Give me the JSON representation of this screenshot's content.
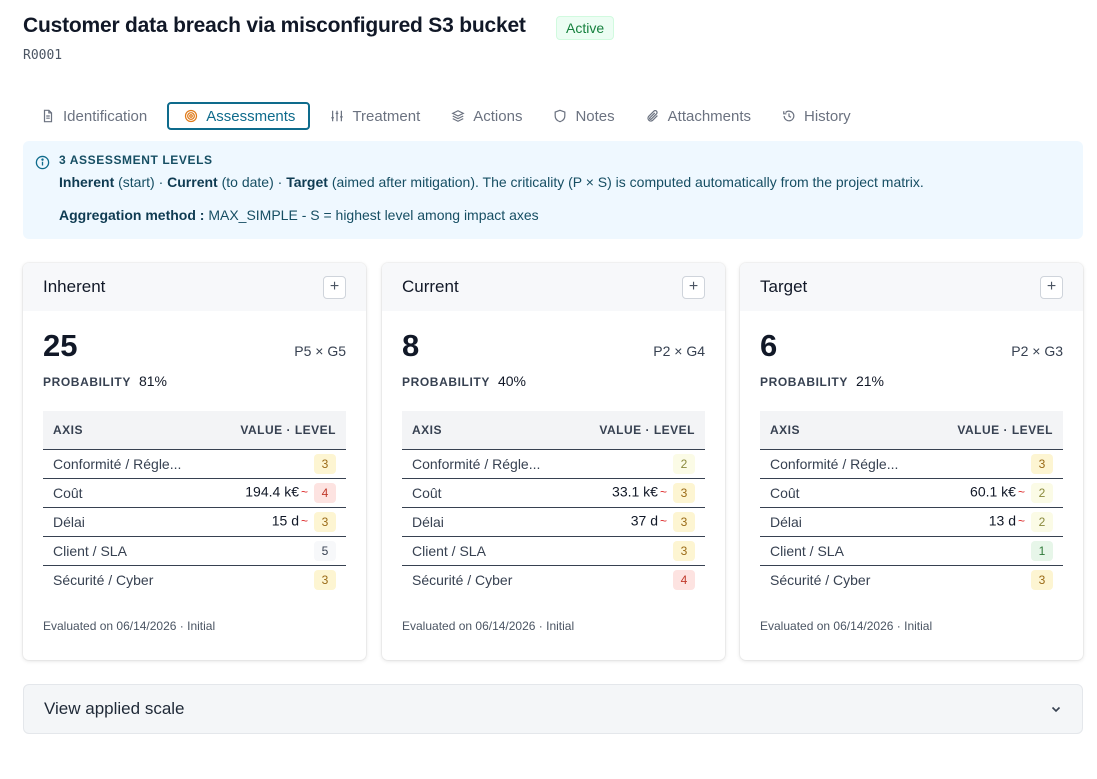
{
  "risk": {
    "title": "Customer data breach via misconfigured S3 bucket",
    "id": "R0001",
    "status": "Active"
  },
  "tabs": [
    {
      "label": "Identification",
      "icon": "document-icon",
      "active": false
    },
    {
      "label": "Assessments",
      "icon": "target-icon",
      "active": true
    },
    {
      "label": "Treatment",
      "icon": "sliders-icon",
      "active": false
    },
    {
      "label": "Actions",
      "icon": "layers-icon",
      "active": false
    },
    {
      "label": "Notes",
      "icon": "shield-icon",
      "active": false
    },
    {
      "label": "Attachments",
      "icon": "paperclip-icon",
      "active": false
    },
    {
      "label": "History",
      "icon": "history-icon",
      "active": false
    }
  ],
  "info": {
    "heading": "3 ASSESSMENT LEVELS",
    "inherent_label": "Inherent",
    "inherent_note": "(start)",
    "current_label": "Current",
    "current_note": "(to date)",
    "target_label": "Target",
    "target_note": "(aimed after mitigation). The criticality (P × S) is computed automatically from the project matrix.",
    "aggregation_label": "Aggregation method :",
    "aggregation_value": "MAX_SIMPLE - S = highest level among impact axes"
  },
  "table_headers": {
    "axis": "AXIS",
    "value_level": "VALUE · LEVEL"
  },
  "probability_label": "PROBABILITY",
  "cards": [
    {
      "title": "Inherent",
      "add_label": "+",
      "score": "25",
      "pg": "P5 × G5",
      "probability": "81%",
      "rows": [
        {
          "axis": "Conformité / Régle...",
          "value": "",
          "tilde": "",
          "level": "3"
        },
        {
          "axis": "Coût",
          "value": "194.4 k€",
          "tilde": "~",
          "level": "4"
        },
        {
          "axis": "Délai",
          "value": "15 d",
          "tilde": "~",
          "level": "3"
        },
        {
          "axis": "Client / SLA",
          "value": "",
          "tilde": "",
          "level": "5"
        },
        {
          "axis": "Sécurité / Cyber",
          "value": "",
          "tilde": "",
          "level": "3"
        }
      ],
      "evaluated": "Evaluated on 06/14/2026 · Initial"
    },
    {
      "title": "Current",
      "add_label": "+",
      "score": "8",
      "pg": "P2 × G4",
      "probability": "40%",
      "rows": [
        {
          "axis": "Conformité / Régle...",
          "value": "",
          "tilde": "",
          "level": "2"
        },
        {
          "axis": "Coût",
          "value": "33.1 k€",
          "tilde": "~",
          "level": "3"
        },
        {
          "axis": "Délai",
          "value": "37 d",
          "tilde": "~",
          "level": "3"
        },
        {
          "axis": "Client / SLA",
          "value": "",
          "tilde": "",
          "level": "3"
        },
        {
          "axis": "Sécurité / Cyber",
          "value": "",
          "tilde": "",
          "level": "4"
        }
      ],
      "evaluated": "Evaluated on 06/14/2026 · Initial"
    },
    {
      "title": "Target",
      "add_label": "+",
      "score": "6",
      "pg": "P2 × G3",
      "probability": "21%",
      "rows": [
        {
          "axis": "Conformité / Régle...",
          "value": "",
          "tilde": "",
          "level": "3"
        },
        {
          "axis": "Coût",
          "value": "60.1 k€",
          "tilde": "~",
          "level": "2"
        },
        {
          "axis": "Délai",
          "value": "13 d",
          "tilde": "~",
          "level": "2"
        },
        {
          "axis": "Client / SLA",
          "value": "",
          "tilde": "",
          "level": "1"
        },
        {
          "axis": "Sécurité / Cyber",
          "value": "",
          "tilde": "",
          "level": "3"
        }
      ],
      "evaluated": "Evaluated on 06/14/2026 · Initial"
    }
  ],
  "scale_toggle": {
    "label": "View applied scale"
  },
  "colors": {
    "accent": "#0e6b8c",
    "status_bg": "#ecfdf3",
    "status_text": "#15803d",
    "info_bg": "#eff8ff",
    "level_1": "#e7f6e9",
    "level_2": "#fbfbe6",
    "level_3": "#fdf5d2",
    "level_4": "#fde3e1"
  }
}
